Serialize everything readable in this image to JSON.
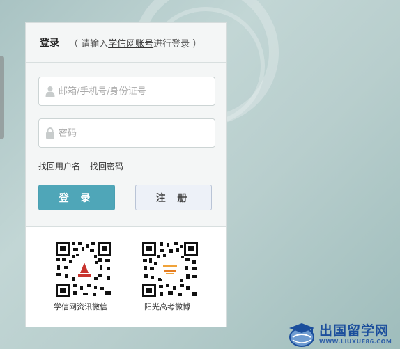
{
  "header": {
    "title": "登录",
    "hint_prefix": "（ 请输入",
    "hint_link": "学信网账号",
    "hint_suffix": "进行登录 ）"
  },
  "form": {
    "username_placeholder": "邮箱/手机号/身份证号",
    "password_placeholder": "密码",
    "forgot_username": "找回用户名",
    "forgot_password": "找回密码",
    "login_label": "登 录",
    "register_label": "注 册"
  },
  "qr": {
    "left_label": "学信网资讯微信",
    "right_label": "阳光高考微博"
  },
  "logo": {
    "main": "出国留学网",
    "sub": "WWW.LIUXUE86.COM"
  },
  "colors": {
    "accent": "#4fa6b8",
    "register_bg": "#edf1f8",
    "logo_blue": "#1b4e9c"
  },
  "icons": {
    "user": "user-icon",
    "lock": "lock-icon"
  }
}
